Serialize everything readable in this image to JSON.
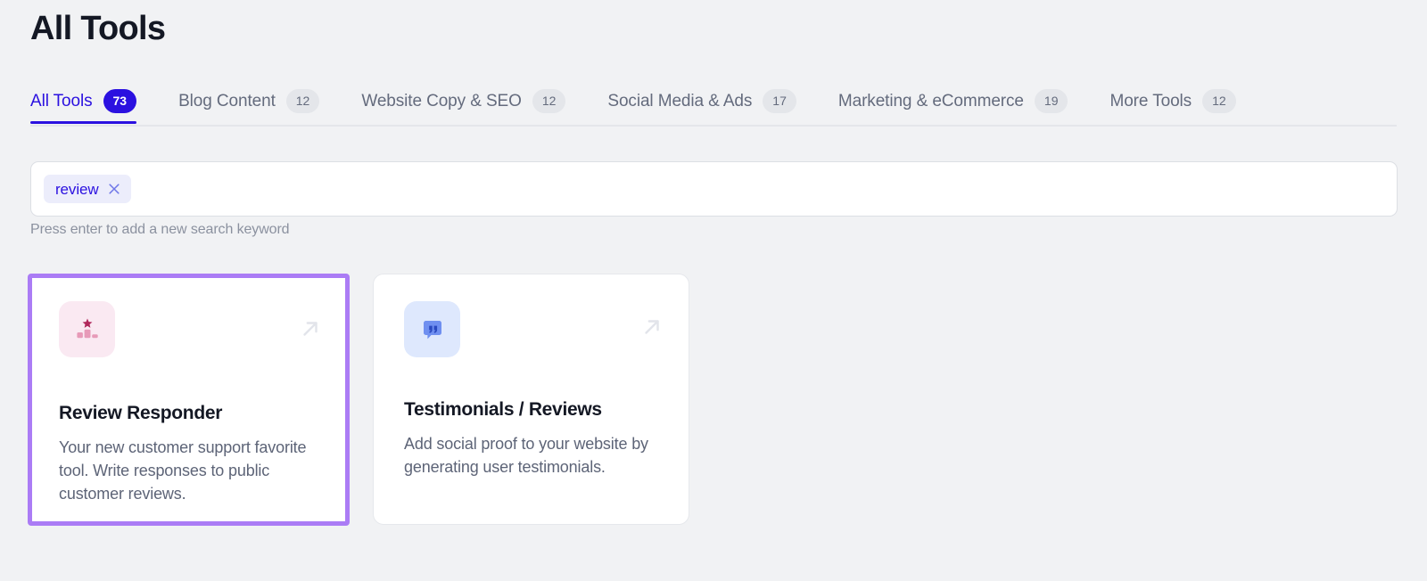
{
  "header": {
    "title": "All Tools"
  },
  "tabs": [
    {
      "label": "All Tools",
      "count": "73",
      "active": true
    },
    {
      "label": "Blog Content",
      "count": "12",
      "active": false
    },
    {
      "label": "Website Copy & SEO",
      "count": "12",
      "active": false
    },
    {
      "label": "Social Media & Ads",
      "count": "17",
      "active": false
    },
    {
      "label": "Marketing & eCommerce",
      "count": "19",
      "active": false
    },
    {
      "label": "More Tools",
      "count": "12",
      "active": false
    }
  ],
  "search": {
    "chips": [
      {
        "label": "review",
        "close_icon": "close-icon"
      }
    ],
    "placeholder": "",
    "hint": "Press enter to add a new search keyword"
  },
  "cards": [
    {
      "title": "Review Responder",
      "description": "Your new customer support favorite tool. Write responses to public customer reviews.",
      "icon_name": "podium-star-icon",
      "icon_bg": "#fae9f2",
      "arrow_icon": "arrow-up-right-icon",
      "selected": true
    },
    {
      "title": "Testimonials / Reviews",
      "description": "Add social proof to your website by generating user testimonials.",
      "icon_name": "quote-bubble-icon",
      "icon_bg": "#dee8fd",
      "arrow_icon": "arrow-up-right-icon",
      "selected": false
    }
  ],
  "colors": {
    "accent": "#2b11e0",
    "selection_border": "#ab7cf5",
    "page_bg": "#f1f2f4",
    "text_dark": "#141824",
    "text_muted": "#646b7d"
  }
}
